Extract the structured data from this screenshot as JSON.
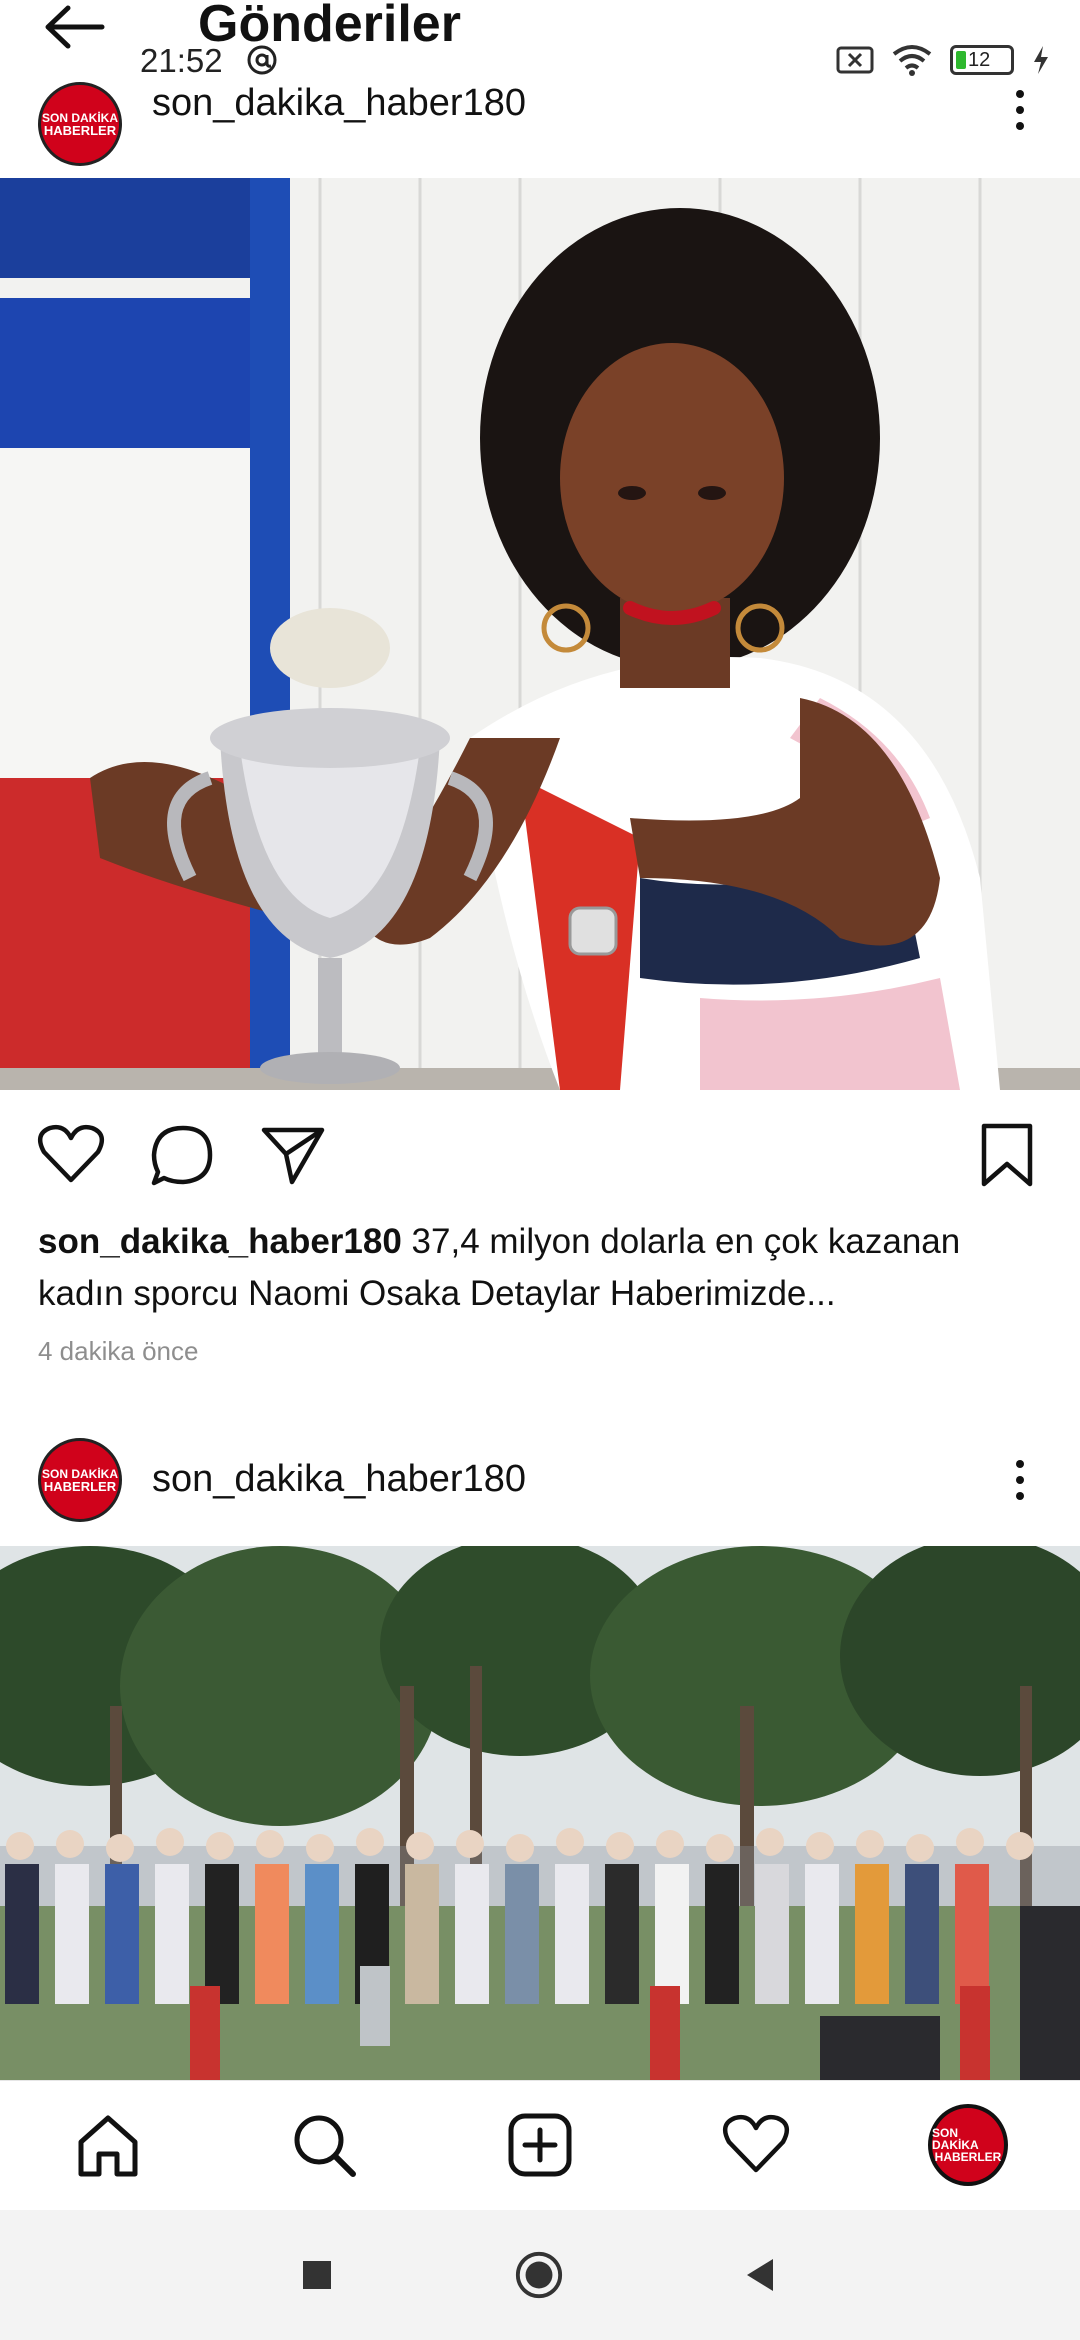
{
  "status": {
    "time": "21:52",
    "battery": "12"
  },
  "header": {
    "title": "Gönderiler"
  },
  "posts": [
    {
      "username": "son_dakika_haber180",
      "avatar_text_top": "SON DAKİKA",
      "avatar_text_bottom": "HABERLER",
      "caption_user": "son_dakika_haber180",
      "caption_text": " 37,4 milyon dolarla en çok kazanan kadın sporcu Naomi Osaka Detaylar Haberimizde...",
      "time_ago": "4 dakika önce"
    },
    {
      "username": "son_dakika_haber180",
      "avatar_text_top": "SON DAKİKA",
      "avatar_text_bottom": "HABERLER"
    }
  ],
  "icons": {
    "back": "back-arrow-icon",
    "like": "heart-icon",
    "comment": "comment-icon",
    "share": "send-icon",
    "save": "bookmark-icon",
    "home": "home-icon",
    "search": "search-icon",
    "add": "add-post-icon",
    "activity": "heart-icon",
    "profile": "profile-avatar"
  },
  "colors": {
    "brand_red": "#d0021b",
    "meta_gray": "#8e8e8e"
  },
  "nav": {
    "profile_avatar_top": "SON DAKİKA",
    "profile_avatar_bottom": "HABERLER"
  }
}
